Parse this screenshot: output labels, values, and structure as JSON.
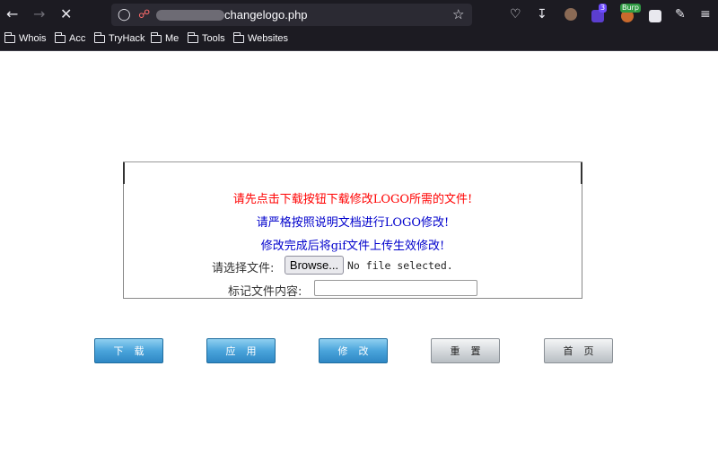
{
  "browser": {
    "url_suffix": "changelogo.php",
    "bookmarks": [
      "Whois",
      "Acc",
      "TryHack",
      "Me",
      "Tools",
      "Websites"
    ],
    "ext_badge_count": "3",
    "ext_badge_burp": "Burp"
  },
  "page": {
    "msg_red": "请先点击下载按钮下载修改LOGO所需的文件!",
    "msg_blue1": "请严格按照说明文档进行LOGO修改!",
    "msg_blue2": "修改完成后将gif文件上传生效修改!",
    "file_label": "请选择文件:",
    "browse_label": "Browse...",
    "file_status": "No file selected.",
    "content_label": "标记文件内容:",
    "content_value": ""
  },
  "buttons": {
    "download": "下载",
    "apply": "应用",
    "modify": "修改",
    "reset": "重置",
    "home": "首页"
  },
  "colors": {
    "red_text": "#ff0000",
    "blue_text": "#0000cc",
    "button_blue": "#4aa4db",
    "button_grey": "#d6dadd"
  }
}
